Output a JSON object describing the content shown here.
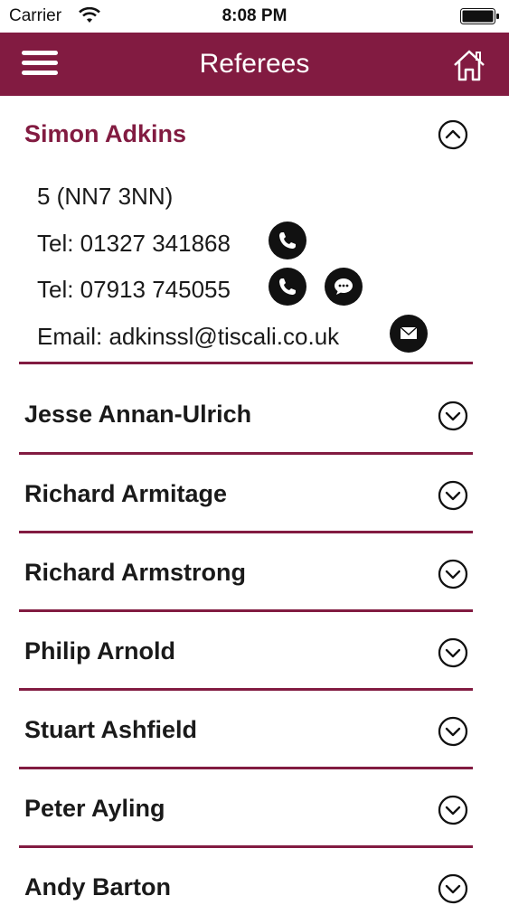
{
  "status_bar": {
    "carrier": "Carrier",
    "time": "8:08 PM"
  },
  "nav": {
    "title": "Referees"
  },
  "expanded": {
    "name": "Simon Adkins",
    "address": "5 (NN7 3NN)",
    "phone1": "Tel: 01327 341868",
    "phone2": "Tel: 07913 745055",
    "email": "Email: adkinssl@tiscali.co.uk"
  },
  "referees": [
    {
      "name": "Jesse Annan-Ulrich"
    },
    {
      "name": "Richard Armitage"
    },
    {
      "name": "Richard Armstrong"
    },
    {
      "name": "Philip Arnold"
    },
    {
      "name": "Stuart Ashfield"
    },
    {
      "name": "Peter Ayling"
    },
    {
      "name": "Andy Barton"
    }
  ],
  "colors": {
    "brand": "#821b41",
    "icon_bg": "#111111"
  }
}
